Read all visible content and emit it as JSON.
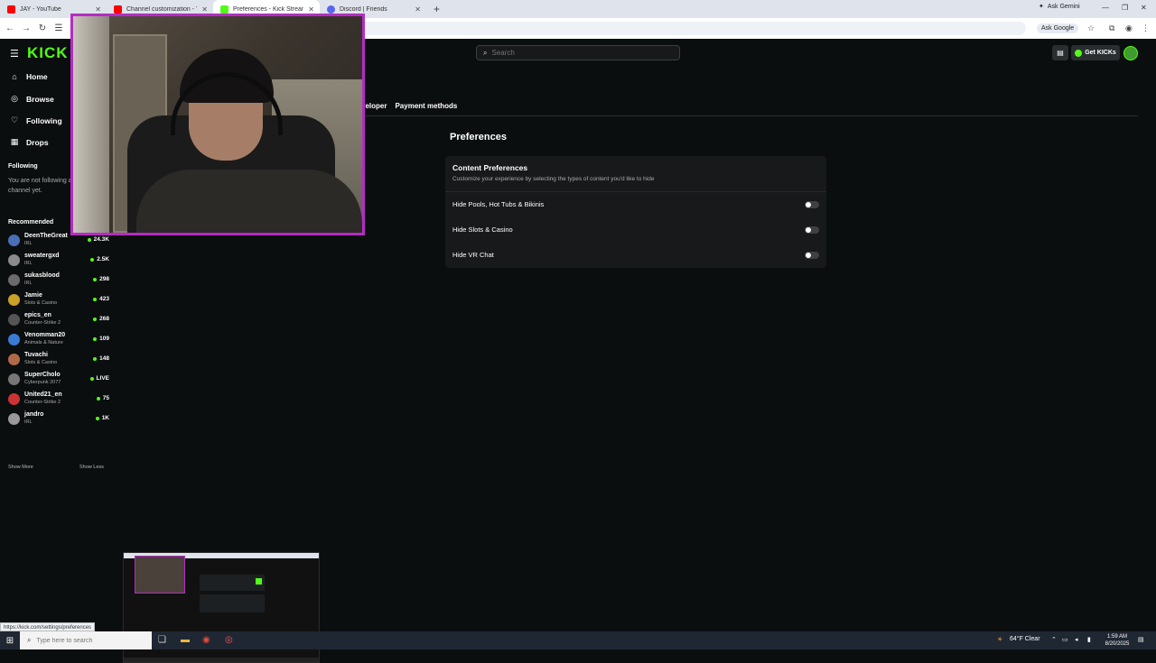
{
  "browser": {
    "tabs": [
      {
        "title": "JAY - YouTube",
        "color": "#ff0000"
      },
      {
        "title": "Channel customization - YouTube",
        "color": "#ff0000"
      },
      {
        "title": "Preferences - Kick Streaming",
        "color": "#53fc18"
      },
      {
        "title": "Discord | Friends",
        "color": "#5865f2"
      }
    ],
    "ask_gemini": "Ask Gemini",
    "ask_google": "Ask Google",
    "status_url": "https://kick.com/settings/preferences"
  },
  "header": {
    "logo": "KICK",
    "search_placeholder": "Search",
    "get_kicks": "Get KICKs"
  },
  "sidebar": {
    "nav": [
      {
        "label": "Home",
        "icon": "home-icon"
      },
      {
        "label": "Browse",
        "icon": "compass-icon"
      },
      {
        "label": "Following",
        "icon": "heart-icon"
      },
      {
        "label": "Drops",
        "icon": "gift-icon"
      }
    ],
    "following_title": "Following",
    "following_empty": "You are not following any channel yet.",
    "recommended_title": "Recommended",
    "recommended": [
      {
        "name": "DeenTheGreat",
        "category": "IRL",
        "viewers": "24.3K",
        "color": "#4a6fb5"
      },
      {
        "name": "sweatergxd",
        "category": "IRL",
        "viewers": "2.5K",
        "color": "#8a8a8a"
      },
      {
        "name": "sukasblood",
        "category": "IRL",
        "viewers": "298",
        "color": "#6b6b6b"
      },
      {
        "name": "Jamie",
        "category": "Slots & Casino",
        "viewers": "423",
        "color": "#c9a227"
      },
      {
        "name": "epics_en",
        "category": "Counter-Strike 2",
        "viewers": "268",
        "color": "#555555"
      },
      {
        "name": "Venomman20",
        "category": "Animals & Nature",
        "viewers": "109",
        "color": "#3a7bd5"
      },
      {
        "name": "Tuvachi",
        "category": "Slots & Casino",
        "viewers": "148",
        "color": "#b06a4a"
      },
      {
        "name": "SuperCholo",
        "category": "Cyberpunk 2077",
        "viewers": "LIVE",
        "color": "#777777"
      },
      {
        "name": "United21_en",
        "category": "Counter-Strike 2",
        "viewers": "75",
        "color": "#cc3333"
      },
      {
        "name": "jandro",
        "category": "IRL",
        "viewers": "1K",
        "color": "#999999"
      }
    ],
    "show_more": "Show More",
    "show_less": "Show Less"
  },
  "settings": {
    "tabs": [
      "veloper",
      "Payment methods"
    ],
    "page_title": "Preferences",
    "card_title": "Content Preferences",
    "card_desc": "Customize your experience by selecting the types of content you'd like to hide",
    "options": [
      {
        "label": "Hide Pools, Hot Tubs & Bikinis",
        "enabled": false
      },
      {
        "label": "Hide Slots & Casino",
        "enabled": false
      },
      {
        "label": "Hide VR Chat",
        "enabled": false
      }
    ]
  },
  "taskbar": {
    "search_placeholder": "Type here to search",
    "weather": "64°F  Clear",
    "time": "1:59 AM",
    "date": "8/20/2025"
  },
  "colors": {
    "brand": "#53fc18",
    "webcam_border": "#b52cc4",
    "background": "#0b0e0f"
  }
}
